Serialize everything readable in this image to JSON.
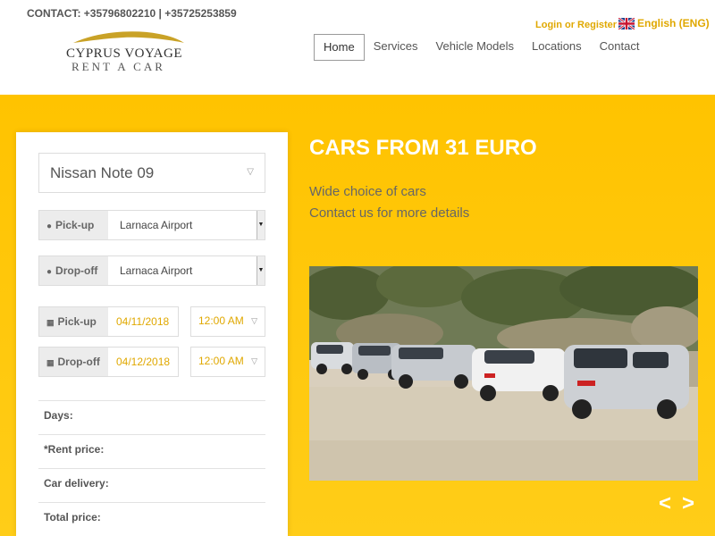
{
  "header": {
    "contact": "CONTACT: +35796802210 | +35725253859",
    "logo_line1": "CYPRUS VOYAGE",
    "logo_line2": "RENT A CAR",
    "login": "Login or Register",
    "language": "English (ENG)",
    "flag_icon": "uk-flag-icon"
  },
  "nav": {
    "items": [
      {
        "label": "Home",
        "active": true
      },
      {
        "label": "Services"
      },
      {
        "label": "Vehicle Models"
      },
      {
        "label": "Locations"
      },
      {
        "label": "Contact"
      }
    ]
  },
  "booking": {
    "car": "Nissan Note 09",
    "pickup_label": "Pick-up",
    "pickup_location": "Larnaca Airport",
    "dropoff_label": "Drop-off",
    "dropoff_location": "Larnaca Airport",
    "pickup_date": "04/11/2018",
    "pickup_time": "12:00 AM",
    "dropoff_date": "04/12/2018",
    "dropoff_time": "12:00 AM",
    "summary": {
      "days": "Days:",
      "rent_price": "*Rent price:",
      "car_delivery": "Car delivery:",
      "total_price": "Total price:"
    }
  },
  "hero": {
    "title": "CARS FROM 31 EURO",
    "line1": "Wide choice of cars",
    "line2": "Contact us for more details",
    "prev": "<",
    "next": ">"
  },
  "colors": {
    "accent": "#ffc300",
    "accent_text": "#e0a800"
  }
}
